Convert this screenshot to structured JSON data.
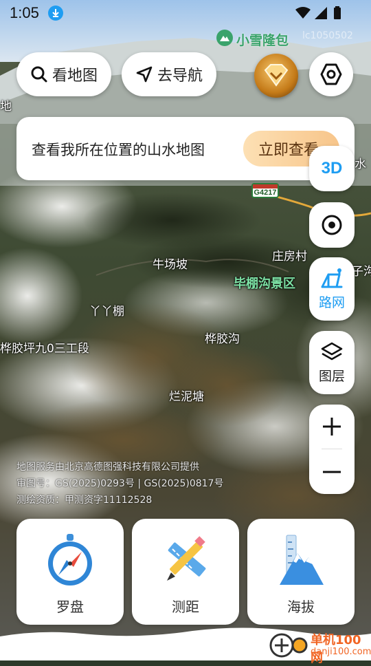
{
  "status_bar": {
    "time": "1:05"
  },
  "top_bar": {
    "view_map_label": "看地图",
    "navigate_label": "去导航"
  },
  "banner": {
    "text": "查看我所在位置的山水地图",
    "button_label": "立即查看"
  },
  "side_controls": {
    "btn_3d_label": "3D",
    "road_network_label": "路网",
    "layers_label": "图层"
  },
  "map_labels": {
    "peak": "小雪隆包",
    "road_shield": "G4217",
    "edge_right_1": "水",
    "edge_right_2": "子沟",
    "edge_left_1": "地",
    "farm_village": "庄房村",
    "scenic_area": "毕棚沟景区",
    "niuchangpo": "牛场坡",
    "yayapeng": "丫丫棚",
    "huapigou": "桦胶沟",
    "worksite": "桦胶坪九0三工段",
    "lanniyu": "烂泥塘",
    "faded_code": "lc1050502"
  },
  "credits": {
    "line1": "地图服务由北京高德图强科技有限公司提供",
    "line2": "审图号：GS(2025)0293号 | GS(2025)0817号",
    "line3": "测绘资质：甲测资字11112528"
  },
  "tools": [
    {
      "label": "罗盘",
      "icon": "compass-icon"
    },
    {
      "label": "测距",
      "icon": "ruler-pencil-icon"
    },
    {
      "label": "海拔",
      "icon": "mountain-altitude-icon"
    }
  ],
  "watermark": {
    "title": "单机100网",
    "url": "danji100.com"
  },
  "colors": {
    "accent_blue": "#1e9df2",
    "banner_button": "#f7c58a",
    "scenic_green": "#7de2a5"
  }
}
